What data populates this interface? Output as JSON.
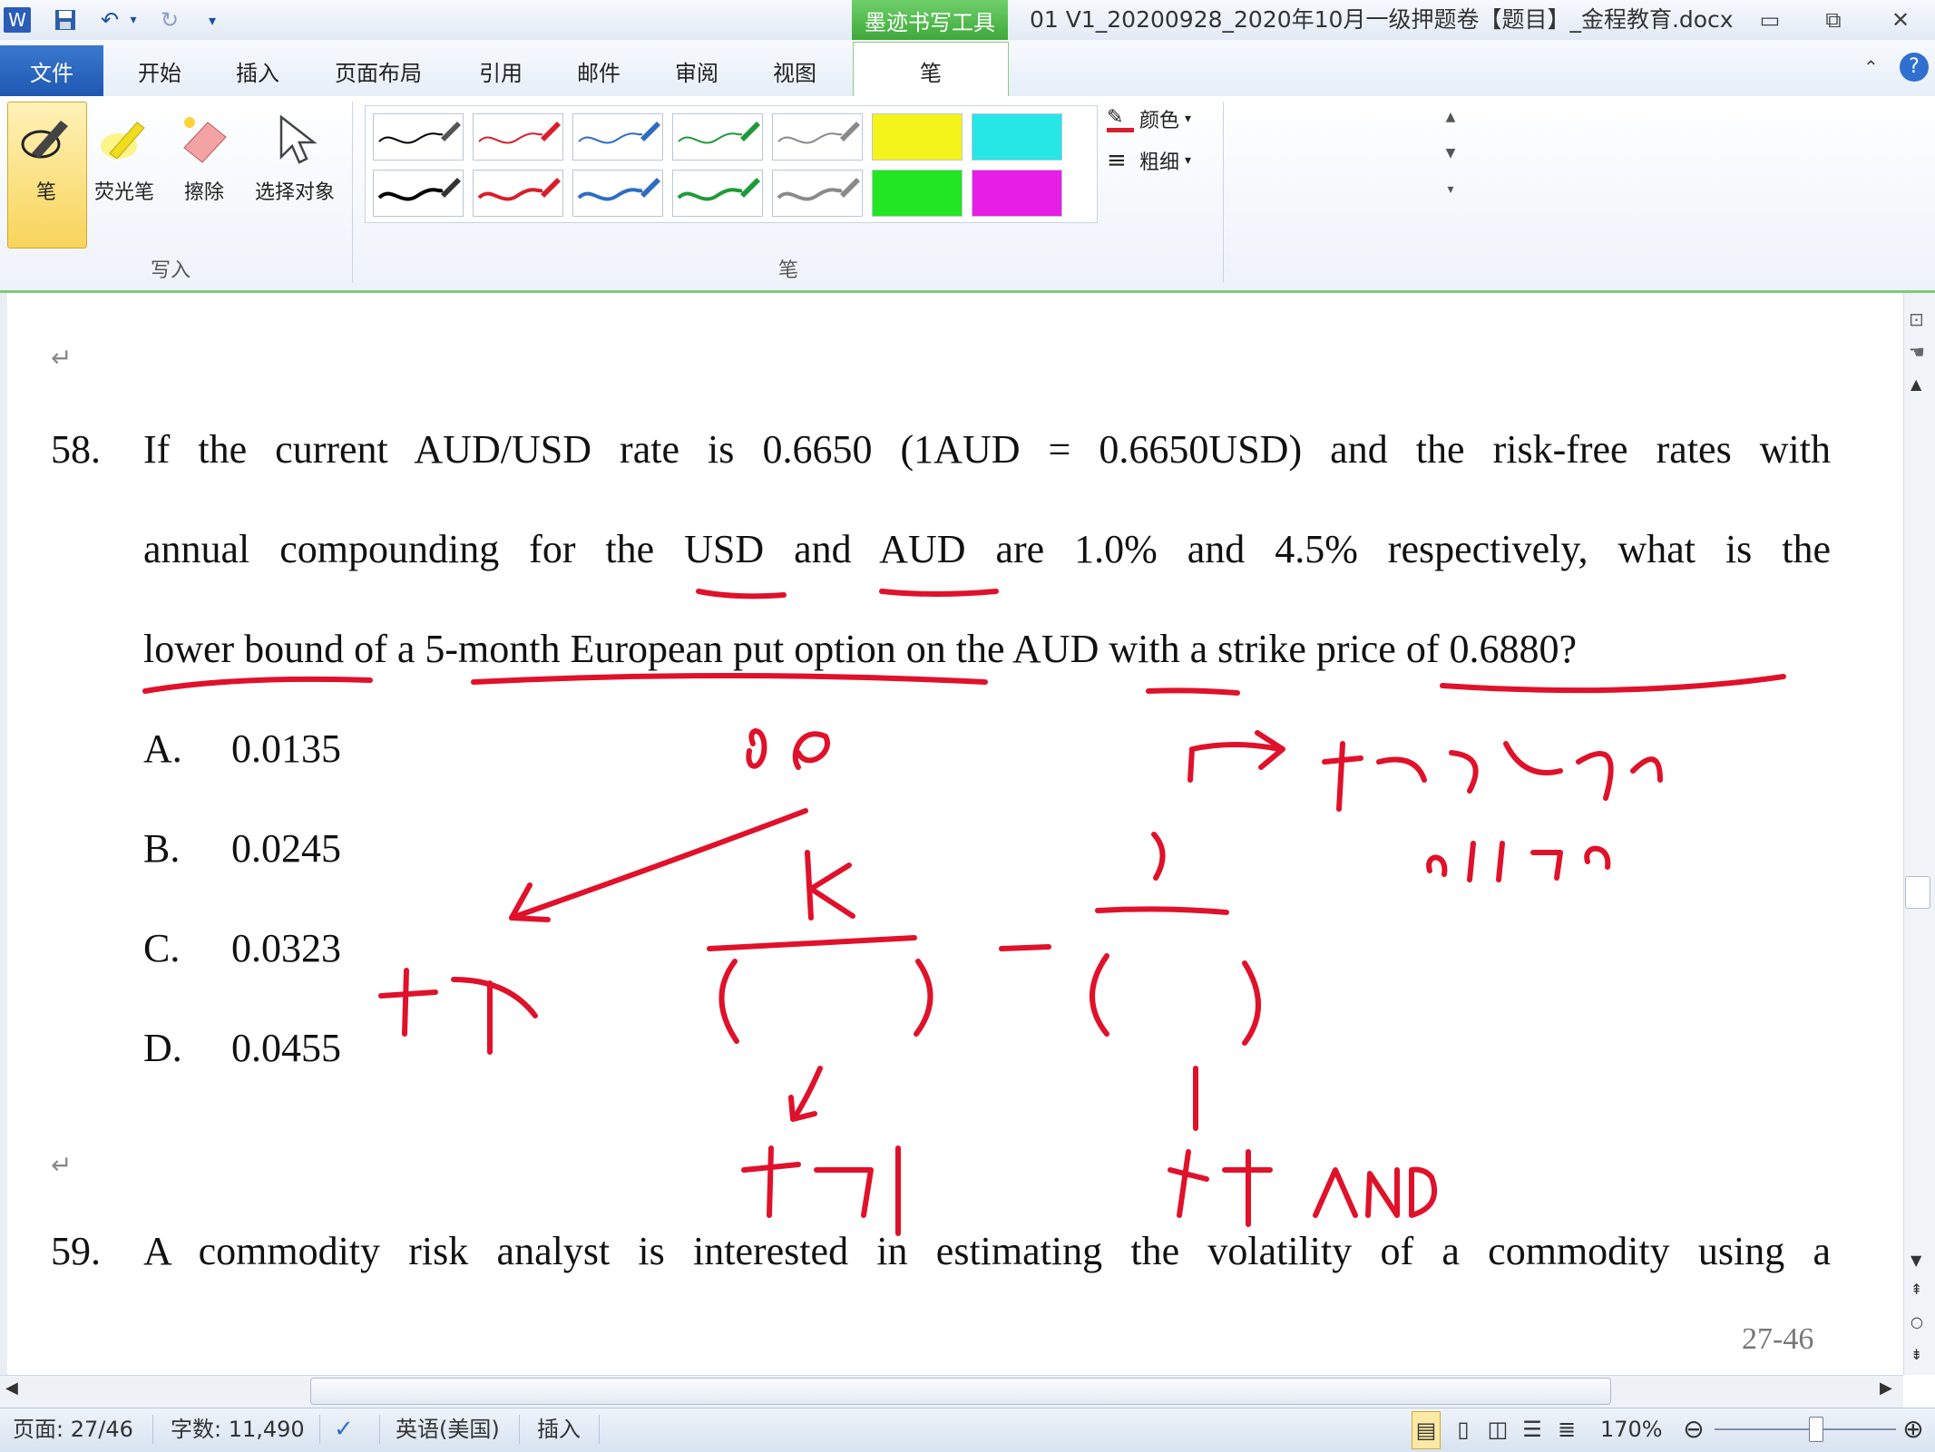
{
  "window": {
    "document_title": "01 V1_20200928_2020年10月一级押题卷【题目】_金程教育.docx",
    "context_tab_title": "墨迹书写工具",
    "app_icon": "word-icon"
  },
  "tabs": [
    "文件",
    "开始",
    "插入",
    "页面布局",
    "引用",
    "邮件",
    "审阅",
    "视图",
    "笔"
  ],
  "ribbon": {
    "write_group": {
      "label": "写入",
      "buttons": [
        "笔",
        "荧光笔",
        "擦除",
        "选择对象"
      ]
    },
    "pens_group": {
      "label": "笔",
      "color_label": "颜色",
      "weight_label": "粗细"
    },
    "pen_colors_row1": [
      "#000000",
      "#d81e2a",
      "#2e6dc2",
      "#1f9a3a",
      "#8a8a8a"
    ],
    "pen_colors_row2": [
      "#000000",
      "#d81e2a",
      "#2e6dc2",
      "#1f9a3a",
      "#8a8a8a"
    ],
    "highlighters_row1": [
      "#f4f41a",
      "#27e6e6"
    ],
    "highlighters_row2": [
      "#22e622",
      "#e61ee6"
    ]
  },
  "document": {
    "q58": {
      "number": "58.",
      "line1": "If the current AUD/USD rate is 0.6650 (1AUD = 0.6650USD) and the risk-free rates with",
      "line2": "annual compounding for the USD and AUD are 1.0% and 4.5% respectively, what is the",
      "line3": "lower bound of a 5-month European put option on the AUD with a strike price of 0.6880?",
      "options": [
        {
          "letter": "A.",
          "value": "0.0135"
        },
        {
          "letter": "B.",
          "value": "0.0245"
        },
        {
          "letter": "C.",
          "value": "0.0323"
        },
        {
          "letter": "D.",
          "value": "0.0455"
        }
      ]
    },
    "q59": {
      "number": "59.",
      "line1": "A commodity risk analyst is interested in estimating the volatility of a commodity using a"
    },
    "page_footer": "27-46"
  },
  "status": {
    "page": "页面: 27/46",
    "words": "字数: 11,490",
    "language": "英语(美国)",
    "mode": "插入",
    "zoom": "170%"
  }
}
